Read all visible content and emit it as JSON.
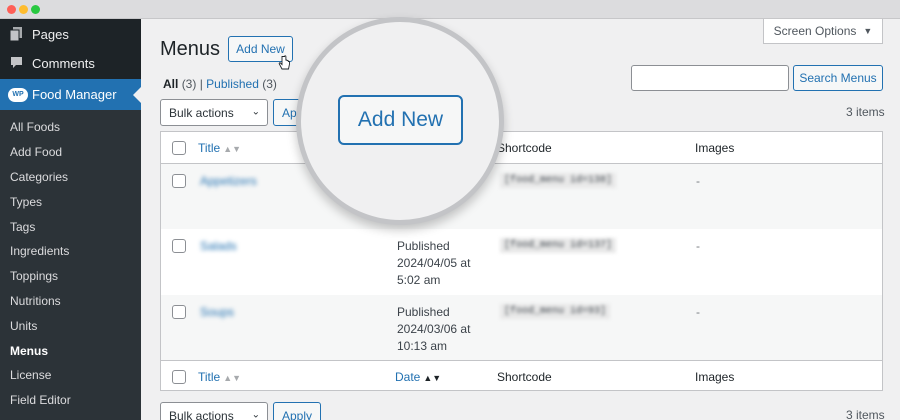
{
  "sidebar": {
    "top_items": [
      {
        "label": "Pages",
        "icon": "pages-icon"
      },
      {
        "label": "Comments",
        "icon": "comments-icon"
      }
    ],
    "active": {
      "label": "Food Manager",
      "badge": "WP"
    },
    "submenu": [
      "All Foods",
      "Add Food",
      "Categories",
      "Types",
      "Tags",
      "Ingredients",
      "Toppings",
      "Nutritions",
      "Units",
      "Menus",
      "License",
      "Field Editor"
    ],
    "current_sub": "Menus"
  },
  "screen_options": {
    "label": "Screen Options",
    "arrow": "▼"
  },
  "page": {
    "title": "Menus",
    "add_new": "Add New"
  },
  "filters": {
    "all_label": "All",
    "all_count": "(3)",
    "separator": "|",
    "published_label": "Published",
    "published_count": "(3)"
  },
  "search": {
    "placeholder": "",
    "button": "Search Menus"
  },
  "bulk": {
    "label": "Bulk actions",
    "apply": "Apply",
    "apply_partial": "Ap"
  },
  "items_count": "3 items",
  "table": {
    "columns": {
      "title": "Title",
      "date": "Date",
      "shortcode": "Shortcode",
      "images": "Images"
    },
    "rows": [
      {
        "title": "Appetizers",
        "date_status": "",
        "date_day": "",
        "date_time": "",
        "shortcode": "[food_menu id=138]",
        "images": "-"
      },
      {
        "title": "Salads",
        "date_status": "Published",
        "date_day": "2024/04/05 at",
        "date_time": "5:02 am",
        "shortcode": "[food_menu id=137]",
        "images": "-"
      },
      {
        "title": "Soups",
        "date_status": "Published",
        "date_day": "2024/03/06 at",
        "date_time": "10:13 am",
        "shortcode": "[food_menu id=93]",
        "images": "-"
      }
    ]
  },
  "magnifier": {
    "button": "Add New"
  },
  "colors": {
    "accent": "#2271b1",
    "sidebar": "#1d2327",
    "submenu": "#2c3338",
    "background": "#f0f0f1"
  }
}
